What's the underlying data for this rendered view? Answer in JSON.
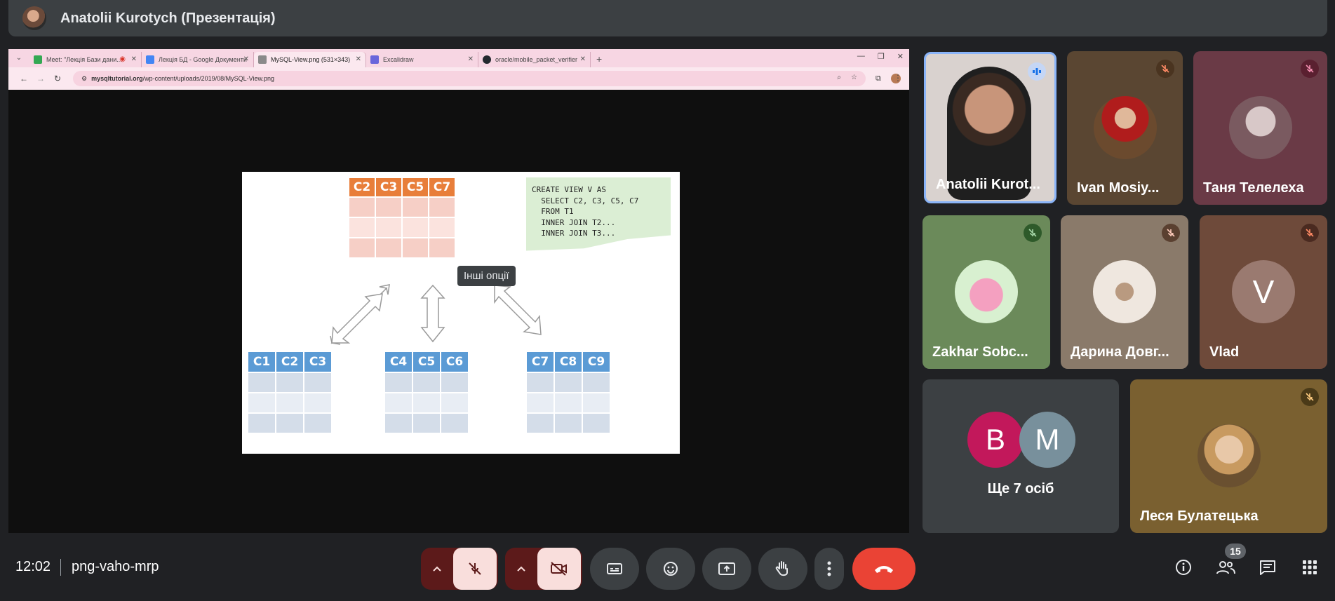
{
  "header": {
    "title": "Anatolii Kurotych (Презентація)"
  },
  "browser": {
    "tabs": [
      {
        "label": "Meet: \"Лекція Бази дани...",
        "active": false
      },
      {
        "label": "Лекція БД - Google Документи",
        "active": false
      },
      {
        "label": "MySQL-View.png (531×343)",
        "active": true
      },
      {
        "label": "Excalidraw",
        "active": false
      },
      {
        "label": "oracle/mobile_packet_verifier",
        "active": false
      }
    ],
    "url_domain": "mysqltutorial.org",
    "url_path": "/wp-content/uploads/2019/08/MySQL-View.png"
  },
  "diagram": {
    "view_columns": [
      "C2",
      "C3",
      "C5",
      "C7"
    ],
    "sql": "CREATE VIEW V AS\n  SELECT C2, C3, C5, C7\n  FROM T1\n  INNER JOIN T2...\n  INNER JOIN T3...",
    "tables": [
      [
        "C1",
        "C2",
        "C3"
      ],
      [
        "C4",
        "C5",
        "C6"
      ],
      [
        "C7",
        "C8",
        "C9"
      ]
    ]
  },
  "tooltip": "Інші опції",
  "participants": {
    "p1": {
      "name": "Anatolii Kurot...",
      "speaking": true
    },
    "p2": {
      "name": "Ivan Mosiy...",
      "muted": true
    },
    "p3": {
      "name": "Таня Телелеха",
      "muted": true
    },
    "p4": {
      "name": "Zakhar Sobc...",
      "muted": true
    },
    "p5": {
      "name": "Дарина Довг...",
      "muted": true
    },
    "p6": {
      "name": "Vlad",
      "initial": "V",
      "muted": true
    },
    "others": {
      "label": "Ще 7 осіб",
      "initials": [
        "B",
        "M"
      ]
    },
    "p7": {
      "name": "Леся Булатецька",
      "muted": true
    }
  },
  "bottom": {
    "time": "12:02",
    "meeting_code": "png-vaho-mrp",
    "people_count": "15"
  },
  "colors": {
    "accent_red": "#ea4335",
    "speaking_blue": "#8ab4f8",
    "view_header": "#e87e3a",
    "table_header": "#5b9bd5"
  }
}
